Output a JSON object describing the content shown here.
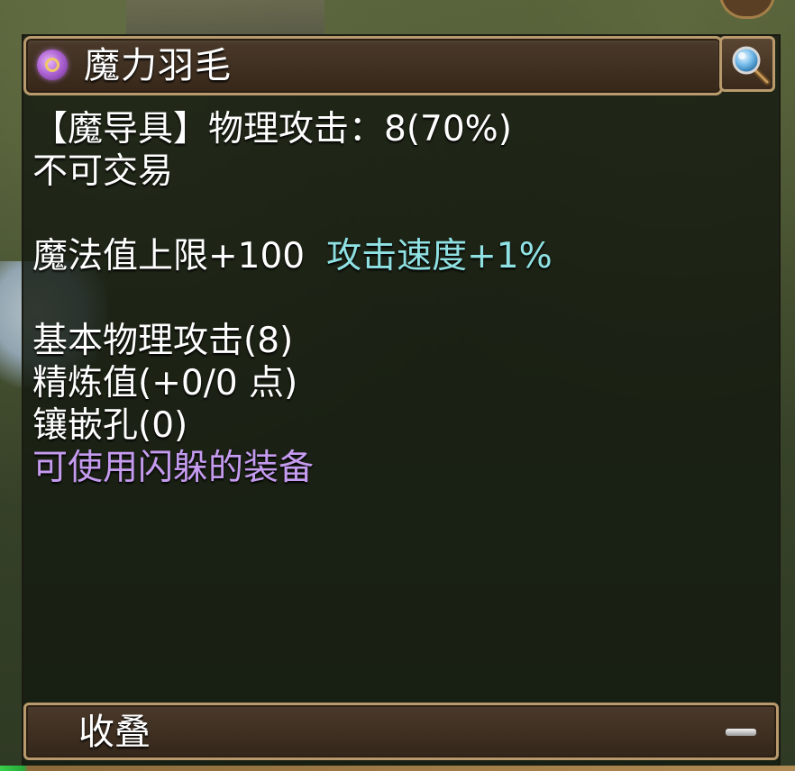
{
  "tooltip": {
    "title": "魔力羽毛",
    "icon": "magic-ring-icon",
    "inspect_icon": "magnifier-icon",
    "lines": {
      "type_attack": "【魔导具】物理攻击：8(70%)",
      "trade": "不可交易",
      "mp_bonus": "魔法值上限+100",
      "speed_bonus": "攻击速度+1%",
      "base_attack": "基本物理攻击(8)",
      "refine": "精炼值(+0/0 点)",
      "sockets": "镶嵌孔(0)",
      "dodge_note": "可使用闪躲的装备"
    },
    "collapse_label": "收叠",
    "collapse_icon": "minus-icon"
  },
  "colors": {
    "text": "#ffffff",
    "bonus": "#8fe1e3",
    "special": "#c59bf0",
    "frame": "#b89a6d"
  }
}
